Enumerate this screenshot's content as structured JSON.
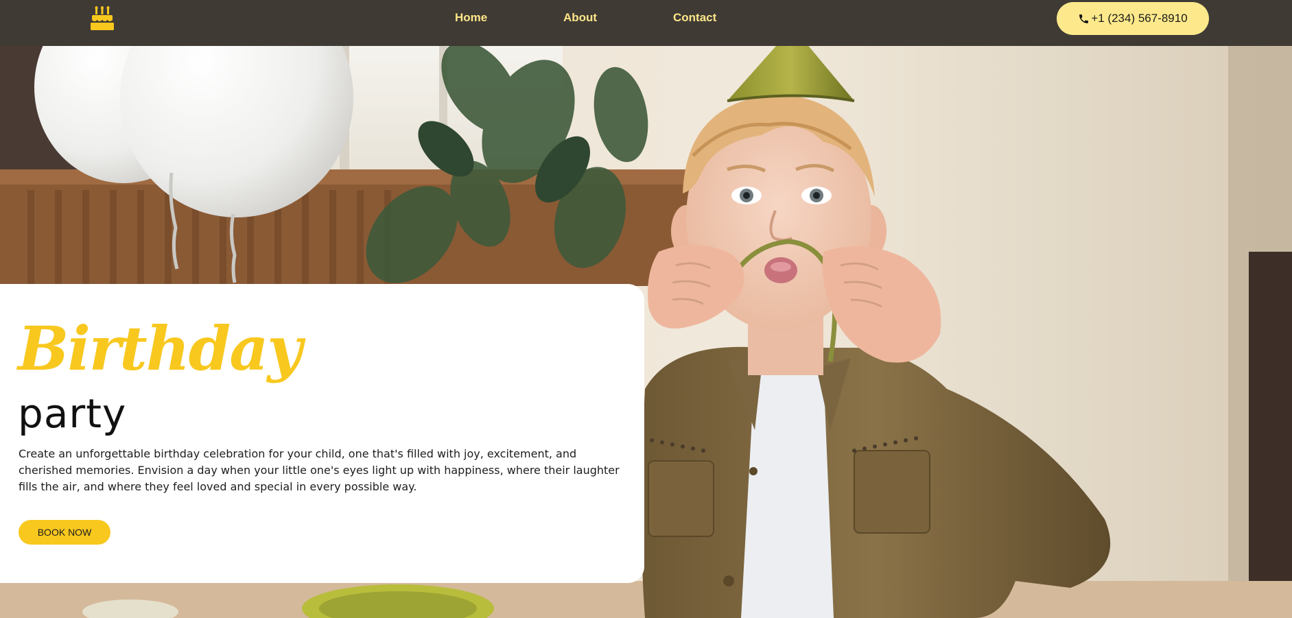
{
  "nav": {
    "logo_icon": "birthday-cake-icon",
    "links": [
      {
        "label": "Home"
      },
      {
        "label": "About"
      },
      {
        "label": "Contact"
      }
    ],
    "phone": {
      "icon": "phone-icon",
      "label": "+1 (234) 567-8910"
    }
  },
  "hero": {
    "image_description": "",
    "title_script": "Birthday",
    "title_sub": "party",
    "description": "Create an unforgettable birthday celebration for your child, one that's filled with joy, excitement, and cherished memories. Envision a day when your little one's eyes light up with happiness, where their laughter fills the air, and where they feel loved and special in every possible way.",
    "cta_label": "BOOK NOW"
  },
  "colors": {
    "nav_bg": "#3f3a34",
    "nav_text": "#fde68a",
    "phone_btn_bg": "#fde98b",
    "accent_yellow": "#f8c81f",
    "card_bg": "#ffffff"
  }
}
